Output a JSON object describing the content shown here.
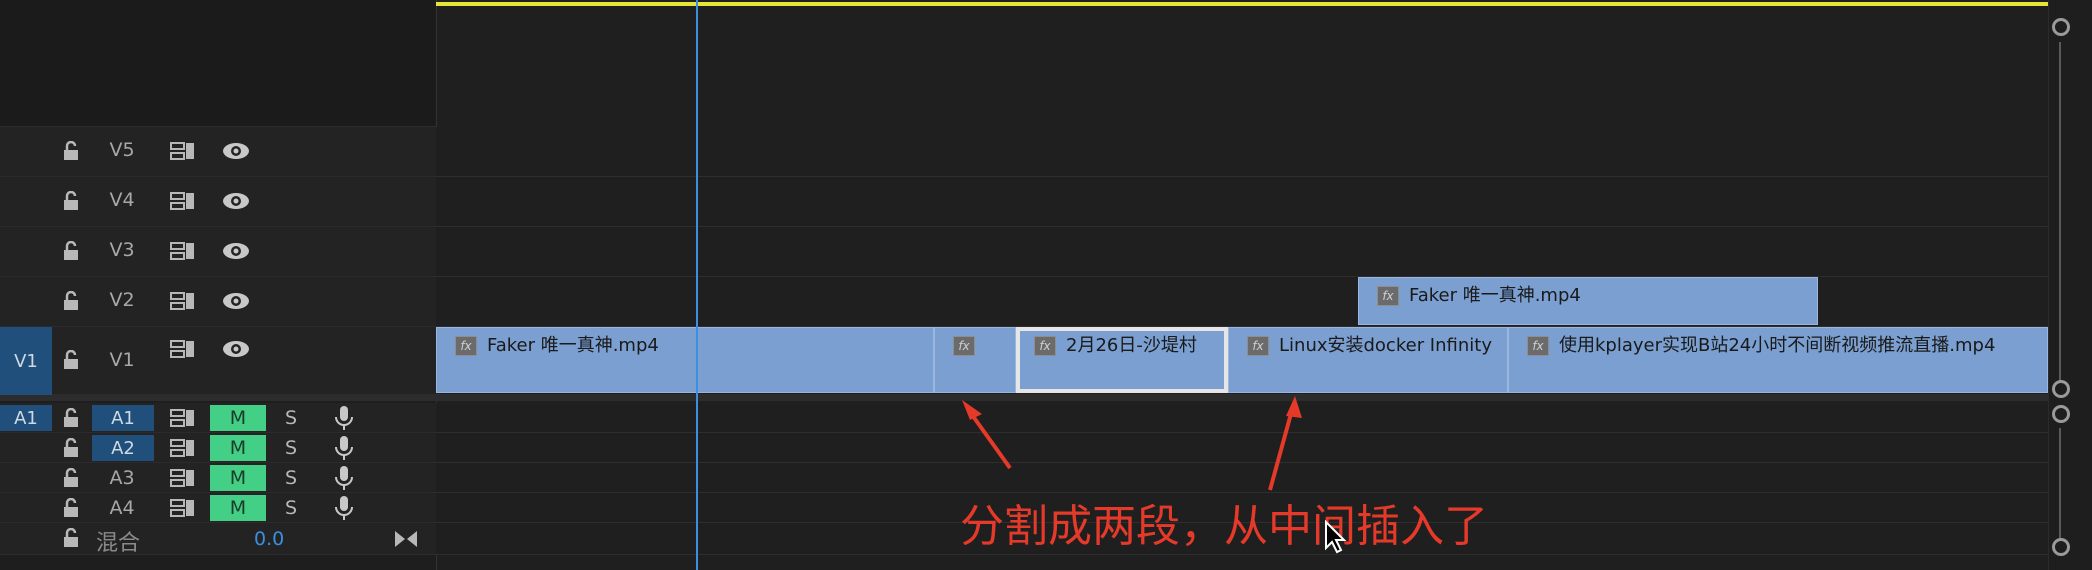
{
  "video_tracks": [
    {
      "id": "V5",
      "source": ""
    },
    {
      "id": "V4",
      "source": ""
    },
    {
      "id": "V3",
      "source": ""
    },
    {
      "id": "V2",
      "source": ""
    },
    {
      "id": "V1",
      "source": "V1"
    }
  ],
  "audio_tracks": [
    {
      "id": "A1",
      "source": "A1",
      "m": "M",
      "s": "S"
    },
    {
      "id": "A2",
      "source": "",
      "m": "M",
      "s": "S"
    },
    {
      "id": "A3",
      "source": "",
      "m": "M",
      "s": "S"
    },
    {
      "id": "A4",
      "source": "",
      "m": "M",
      "s": "S"
    }
  ],
  "mix": {
    "label": "混合",
    "value": "0.0"
  },
  "clips_v1": [
    {
      "name": "Faker 唯一真神.mp4",
      "fx": "fx"
    },
    {
      "name": "",
      "fx": "fx"
    },
    {
      "name": "2月26日-沙堤村",
      "fx": "fx"
    },
    {
      "name": "Linux安装docker Infinity",
      "fx": "fx"
    },
    {
      "name": "使用kplayer实现B站24小时不间断视频推流直播.mp4",
      "fx": "fx"
    }
  ],
  "clips_v2": [
    {
      "name": "Faker 唯一真神.mp4",
      "fx": "fx"
    }
  ],
  "annotation": {
    "text": "分割成两段，从中间插入了",
    "color": "#e53a2a"
  },
  "colors": {
    "clip": "#7a9fd0",
    "mute": "#43d086",
    "playhead": "#3b8fe0",
    "work_area": "#e8e43a",
    "source_patch": "#1f4f7a"
  }
}
